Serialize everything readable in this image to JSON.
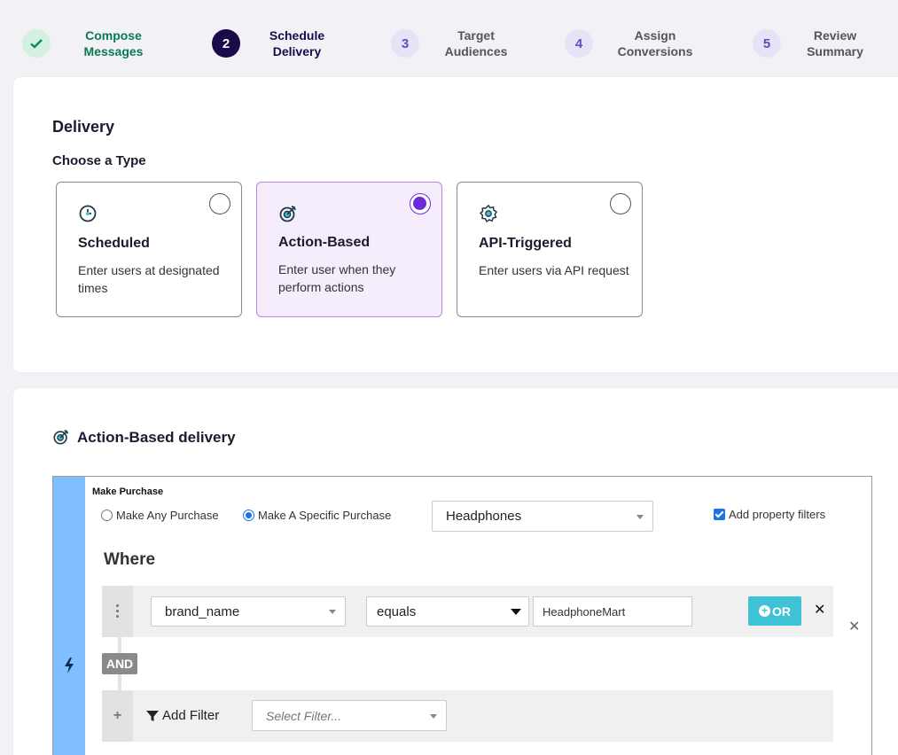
{
  "stepper": {
    "steps": [
      {
        "number": "✓",
        "label": "Compose Messages",
        "state": "done"
      },
      {
        "number": "2",
        "label": "Schedule Delivery",
        "state": "active"
      },
      {
        "number": "3",
        "label": "Target Audiences",
        "state": "todo"
      },
      {
        "number": "4",
        "label": "Assign Conversions",
        "state": "todo"
      },
      {
        "number": "5",
        "label": "Review Summary",
        "state": "todo"
      }
    ]
  },
  "delivery": {
    "heading": "Delivery",
    "choose_label": "Choose a Type",
    "types": [
      {
        "icon": "clock-icon",
        "title": "Scheduled",
        "description": "Enter users at designated times",
        "selected": false
      },
      {
        "icon": "target-icon",
        "title": "Action-Based",
        "description": "Enter user when they perform actions",
        "selected": true
      },
      {
        "icon": "gear-icon",
        "title": "API-Triggered",
        "description": "Enter users via API request",
        "selected": false
      }
    ]
  },
  "action_based": {
    "heading": "Action-Based delivery",
    "trigger": {
      "label": "Make Purchase",
      "option_any": "Make Any Purchase",
      "option_specific": "Make A Specific Purchase",
      "selected_option": "specific",
      "product_select": "Headphones",
      "property_filters_label": "Add property filters",
      "property_filters_checked": true,
      "where_label": "Where",
      "filter": {
        "property": "brand_name",
        "operator": "equals",
        "value": "HeadphoneMart",
        "or_label": "OR",
        "remove_label": "✕"
      },
      "and_label": "AND",
      "add_filter_label": "Add Filter",
      "select_filter_placeholder": "Select Filter...",
      "close_label": "✕"
    }
  },
  "colors": {
    "accent_purple": "#6c2bd9",
    "trigger_bar": "#7fbfff",
    "or_button": "#3fc1d6",
    "step_done": "#0a8a5a",
    "step_active": "#1b0a4a"
  }
}
